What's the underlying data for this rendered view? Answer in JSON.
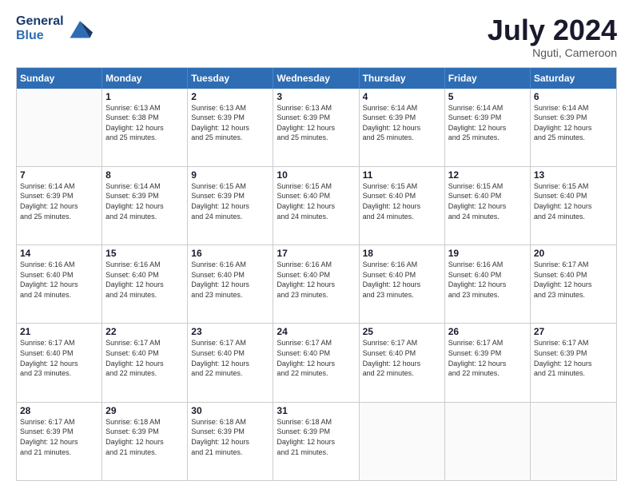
{
  "header": {
    "logo_line1": "General",
    "logo_line2": "Blue",
    "month_year": "July 2024",
    "location": "Nguti, Cameroon"
  },
  "days_of_week": [
    "Sunday",
    "Monday",
    "Tuesday",
    "Wednesday",
    "Thursday",
    "Friday",
    "Saturday"
  ],
  "weeks": [
    [
      {
        "day": "",
        "info": ""
      },
      {
        "day": "1",
        "info": "Sunrise: 6:13 AM\nSunset: 6:38 PM\nDaylight: 12 hours\nand 25 minutes."
      },
      {
        "day": "2",
        "info": "Sunrise: 6:13 AM\nSunset: 6:39 PM\nDaylight: 12 hours\nand 25 minutes."
      },
      {
        "day": "3",
        "info": "Sunrise: 6:13 AM\nSunset: 6:39 PM\nDaylight: 12 hours\nand 25 minutes."
      },
      {
        "day": "4",
        "info": "Sunrise: 6:14 AM\nSunset: 6:39 PM\nDaylight: 12 hours\nand 25 minutes."
      },
      {
        "day": "5",
        "info": "Sunrise: 6:14 AM\nSunset: 6:39 PM\nDaylight: 12 hours\nand 25 minutes."
      },
      {
        "day": "6",
        "info": "Sunrise: 6:14 AM\nSunset: 6:39 PM\nDaylight: 12 hours\nand 25 minutes."
      }
    ],
    [
      {
        "day": "7",
        "info": "Sunrise: 6:14 AM\nSunset: 6:39 PM\nDaylight: 12 hours\nand 25 minutes."
      },
      {
        "day": "8",
        "info": "Sunrise: 6:14 AM\nSunset: 6:39 PM\nDaylight: 12 hours\nand 24 minutes."
      },
      {
        "day": "9",
        "info": "Sunrise: 6:15 AM\nSunset: 6:39 PM\nDaylight: 12 hours\nand 24 minutes."
      },
      {
        "day": "10",
        "info": "Sunrise: 6:15 AM\nSunset: 6:40 PM\nDaylight: 12 hours\nand 24 minutes."
      },
      {
        "day": "11",
        "info": "Sunrise: 6:15 AM\nSunset: 6:40 PM\nDaylight: 12 hours\nand 24 minutes."
      },
      {
        "day": "12",
        "info": "Sunrise: 6:15 AM\nSunset: 6:40 PM\nDaylight: 12 hours\nand 24 minutes."
      },
      {
        "day": "13",
        "info": "Sunrise: 6:15 AM\nSunset: 6:40 PM\nDaylight: 12 hours\nand 24 minutes."
      }
    ],
    [
      {
        "day": "14",
        "info": "Sunrise: 6:16 AM\nSunset: 6:40 PM\nDaylight: 12 hours\nand 24 minutes."
      },
      {
        "day": "15",
        "info": "Sunrise: 6:16 AM\nSunset: 6:40 PM\nDaylight: 12 hours\nand 24 minutes."
      },
      {
        "day": "16",
        "info": "Sunrise: 6:16 AM\nSunset: 6:40 PM\nDaylight: 12 hours\nand 23 minutes."
      },
      {
        "day": "17",
        "info": "Sunrise: 6:16 AM\nSunset: 6:40 PM\nDaylight: 12 hours\nand 23 minutes."
      },
      {
        "day": "18",
        "info": "Sunrise: 6:16 AM\nSunset: 6:40 PM\nDaylight: 12 hours\nand 23 minutes."
      },
      {
        "day": "19",
        "info": "Sunrise: 6:16 AM\nSunset: 6:40 PM\nDaylight: 12 hours\nand 23 minutes."
      },
      {
        "day": "20",
        "info": "Sunrise: 6:17 AM\nSunset: 6:40 PM\nDaylight: 12 hours\nand 23 minutes."
      }
    ],
    [
      {
        "day": "21",
        "info": "Sunrise: 6:17 AM\nSunset: 6:40 PM\nDaylight: 12 hours\nand 23 minutes."
      },
      {
        "day": "22",
        "info": "Sunrise: 6:17 AM\nSunset: 6:40 PM\nDaylight: 12 hours\nand 22 minutes."
      },
      {
        "day": "23",
        "info": "Sunrise: 6:17 AM\nSunset: 6:40 PM\nDaylight: 12 hours\nand 22 minutes."
      },
      {
        "day": "24",
        "info": "Sunrise: 6:17 AM\nSunset: 6:40 PM\nDaylight: 12 hours\nand 22 minutes."
      },
      {
        "day": "25",
        "info": "Sunrise: 6:17 AM\nSunset: 6:40 PM\nDaylight: 12 hours\nand 22 minutes."
      },
      {
        "day": "26",
        "info": "Sunrise: 6:17 AM\nSunset: 6:39 PM\nDaylight: 12 hours\nand 22 minutes."
      },
      {
        "day": "27",
        "info": "Sunrise: 6:17 AM\nSunset: 6:39 PM\nDaylight: 12 hours\nand 21 minutes."
      }
    ],
    [
      {
        "day": "28",
        "info": "Sunrise: 6:17 AM\nSunset: 6:39 PM\nDaylight: 12 hours\nand 21 minutes."
      },
      {
        "day": "29",
        "info": "Sunrise: 6:18 AM\nSunset: 6:39 PM\nDaylight: 12 hours\nand 21 minutes."
      },
      {
        "day": "30",
        "info": "Sunrise: 6:18 AM\nSunset: 6:39 PM\nDaylight: 12 hours\nand 21 minutes."
      },
      {
        "day": "31",
        "info": "Sunrise: 6:18 AM\nSunset: 6:39 PM\nDaylight: 12 hours\nand 21 minutes."
      },
      {
        "day": "",
        "info": ""
      },
      {
        "day": "",
        "info": ""
      },
      {
        "day": "",
        "info": ""
      }
    ]
  ]
}
